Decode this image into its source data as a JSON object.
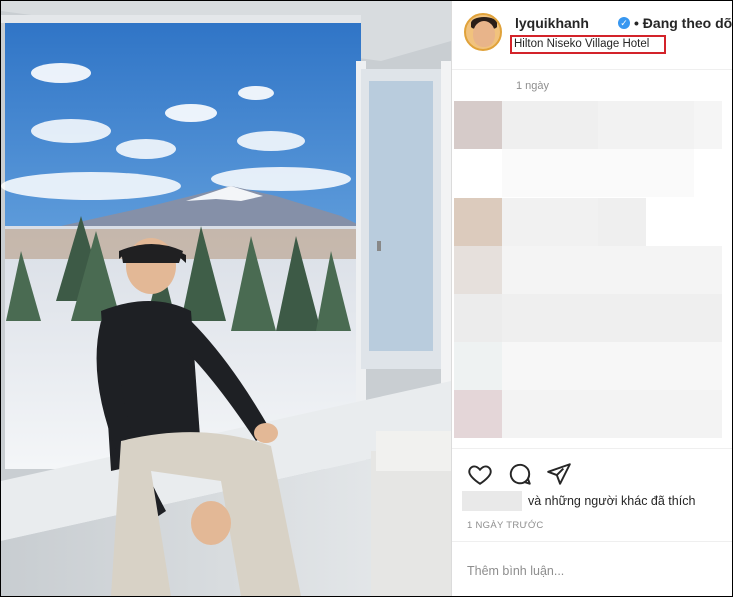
{
  "post": {
    "username": "lyquikhanh",
    "follow_status": "• Đang theo dõi",
    "location": "Hilton Niseko Village Hotel",
    "time_ago": "1 ngày",
    "likes_text": "và những người khác đã thích",
    "date_label": "1 NGÀY TRƯỚC",
    "comment_placeholder": "Thêm bình luận..."
  },
  "icons": {
    "like": "heart-icon",
    "comment": "comment-icon",
    "share": "share-icon",
    "verified": "verified-badge-icon"
  },
  "colors": {
    "highlight": "#d3232a",
    "verified": "#3897f0",
    "muted_text": "#8e8e8e"
  }
}
